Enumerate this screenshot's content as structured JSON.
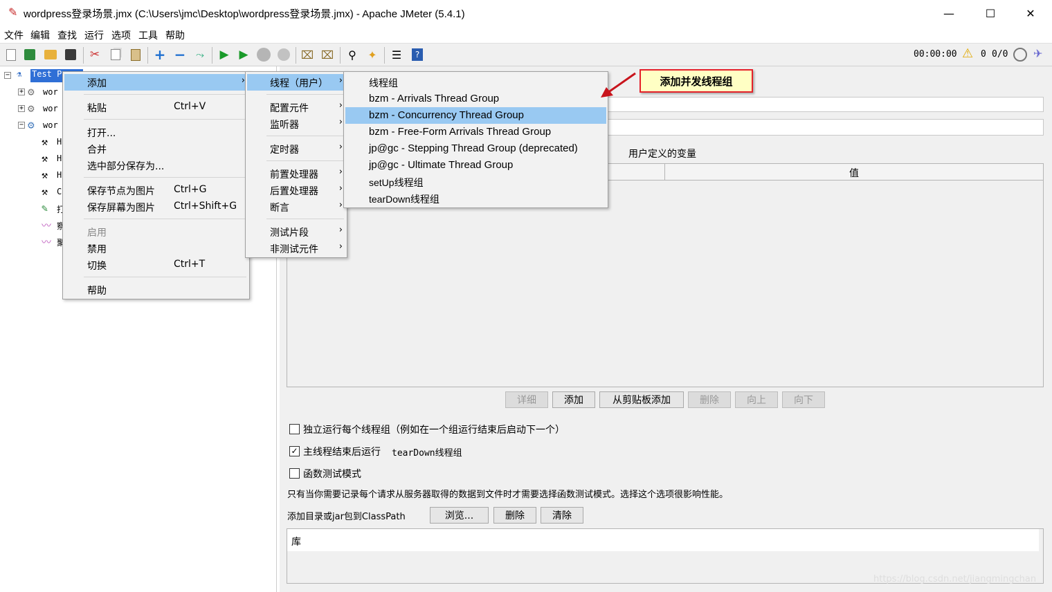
{
  "window": {
    "title": "wordpress登录场景.jmx (C:\\Users\\jmc\\Desktop\\wordpress登录场景.jmx) - Apache JMeter (5.4.1)"
  },
  "menubar": [
    "文件",
    "编辑",
    "查找",
    "运行",
    "选项",
    "工具",
    "帮助"
  ],
  "toolbar": {
    "timer": "00:00:00",
    "warnings": "0",
    "threads": "0/0"
  },
  "tree": {
    "root": "Test P",
    "items": [
      "wor",
      "wor",
      "wor",
      "H",
      "H",
      "H",
      "C",
      "打",
      "察",
      "聚"
    ]
  },
  "context_menu": {
    "items": [
      {
        "label": "添加",
        "shortcut": "",
        "arrow": true,
        "highlight": true
      },
      {
        "label": "粘贴",
        "shortcut": "Ctrl+V"
      },
      {
        "label": "打开...",
        "shortcut": ""
      },
      {
        "label": "合并",
        "shortcut": ""
      },
      {
        "label": "选中部分保存为...",
        "shortcut": ""
      },
      {
        "label": "保存节点为图片",
        "shortcut": "Ctrl+G"
      },
      {
        "label": "保存屏幕为图片",
        "shortcut": "Ctrl+Shift+G"
      },
      {
        "label": "启用",
        "shortcut": "",
        "disabled": true
      },
      {
        "label": "禁用",
        "shortcut": ""
      },
      {
        "label": "切换",
        "shortcut": "Ctrl+T"
      },
      {
        "label": "帮助",
        "shortcut": ""
      }
    ]
  },
  "add_submenu": {
    "items": [
      "线程（用户）",
      "配置元件",
      "监听器",
      "定时器",
      "前置处理器",
      "后置处理器",
      "断言",
      "测试片段",
      "非测试元件"
    ]
  },
  "thread_submenu": {
    "items": [
      "线程组",
      "bzm - Arrivals Thread Group",
      "bzm - Concurrency Thread Group",
      "bzm - Free-Form Arrivals Thread Group",
      "jp@gc - Stepping Thread Group (deprecated)",
      "jp@gc - Ultimate Thread Group",
      "setUp线程组",
      "tearDown线程组"
    ],
    "highlighted": "bzm - Concurrency Thread Group"
  },
  "callout": "添加并发线程组",
  "panel": {
    "user_vars_title": "用户定义的变量",
    "col_value": "值",
    "buttons": {
      "detail": "详细",
      "add": "添加",
      "add_clipboard": "从剪贴板添加",
      "delete": "删除",
      "up": "向上",
      "down": "向下"
    },
    "cb1": "独立运行每个线程组（例如在一个组运行结束后启动下一个）",
    "cb2_a": "主线程结束后运行",
    "cb2_b": "tearDown线程组",
    "cb3": "函数测试模式",
    "note": "只有当你需要记录每个请求从服务器取得的数据到文件时才需要选择函数测试模式。选择这个选项很影响性能。",
    "classpath_label": "添加目录或jar包到ClassPath",
    "browse": "浏览...",
    "remove": "删除",
    "clear": "清除",
    "lib_header": "库"
  },
  "watermark": "https://blog.csdn.net/jiangmingchan"
}
